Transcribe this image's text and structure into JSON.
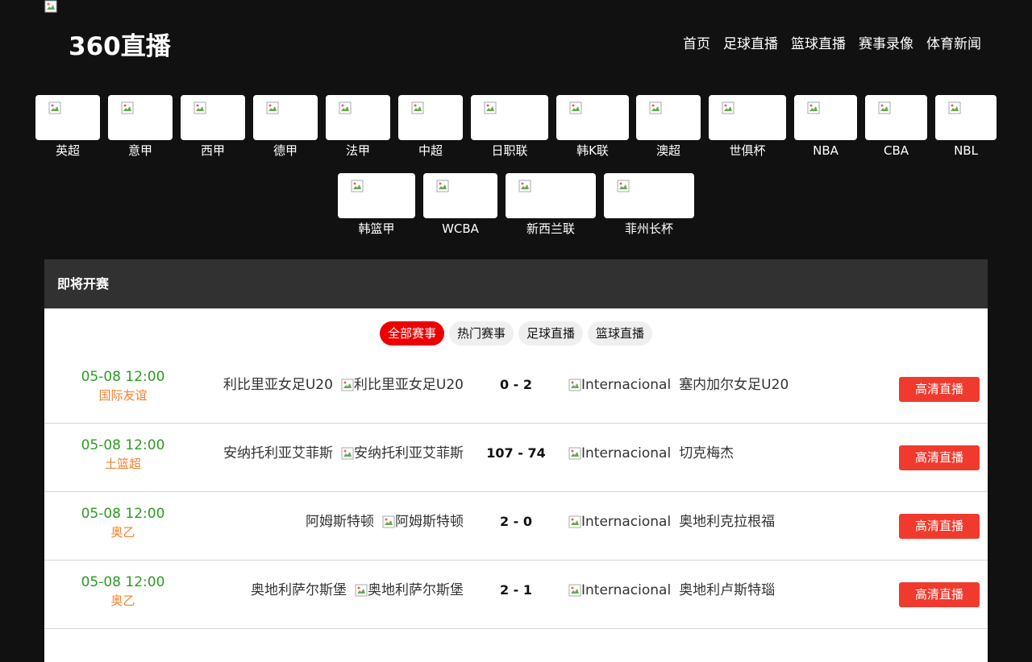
{
  "header": {
    "logo_text": "360直播",
    "nav": [
      "首页",
      "足球直播",
      "篮球直播",
      "赛事录像",
      "体育新闻"
    ]
  },
  "leagues_row1": [
    "英超",
    "意甲",
    "西甲",
    "德甲",
    "法甲",
    "中超",
    "日职联",
    "韩K联",
    "澳超",
    "世俱杯",
    "NBA",
    "CBA",
    "NBL"
  ],
  "leagues_row2": [
    "韩篮甲",
    "WCBA",
    "新西兰联",
    "菲州长杯"
  ],
  "section": {
    "title": "即将开赛",
    "filters": [
      "全部赛事",
      "热门赛事",
      "足球直播",
      "篮球直播"
    ],
    "active_filter": "全部赛事"
  },
  "matches": [
    {
      "time": "05-08 12:00",
      "league": "国际友谊",
      "home": "利比里亚女足U20",
      "home_img_alt": "利比里亚女足U20",
      "score": "0 - 2",
      "away_img_alt": "Internacional",
      "away": "塞内加尔女足U20",
      "button": "高清直播"
    },
    {
      "time": "05-08 12:00",
      "league": "土篮超",
      "home": "安纳托利亚艾菲斯",
      "home_img_alt": "安纳托利亚艾菲斯",
      "score": "107 - 74",
      "away_img_alt": "Internacional",
      "away": "切克梅杰",
      "button": "高清直播"
    },
    {
      "time": "05-08 12:00",
      "league": "奥乙",
      "home": "阿姆斯特顿",
      "home_img_alt": "阿姆斯特顿",
      "score": "2 - 0",
      "away_img_alt": "Internacional",
      "away": "奥地利克拉根福",
      "button": "高清直播"
    },
    {
      "time": "05-08 12:00",
      "league": "奥乙",
      "home": "奥地利萨尔斯堡",
      "home_img_alt": "奥地利萨尔斯堡",
      "score": "2 - 1",
      "away_img_alt": "Internacional",
      "away": "奥地利卢斯特瑙",
      "button": "高清直播"
    }
  ]
}
